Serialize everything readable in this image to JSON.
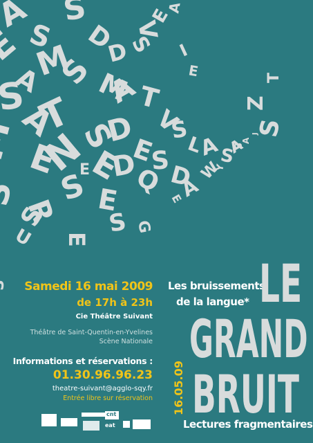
{
  "event": {
    "date": "Samedi 16 mai 2009",
    "hours": "de 17h à 23h",
    "company": "Cie Théâtre Suivant",
    "venue_line1": "Théâtre de Saint-Quentin-en-Yvelines",
    "venue_line2": "Scène Nationale",
    "info_title": "Informations et réservations :",
    "phone": "01.30.96.96.23",
    "email": "theatre-suivant@agglo-sqy.fr",
    "admission": "Entrée libre sur réservation"
  },
  "title": {
    "subtitle_line1": "Les bruissements",
    "subtitle_line2": "de la langue*",
    "line1": "LE",
    "line2": "GRAND",
    "line3": "BRUIT",
    "tagline": "Lectures fragmentaires",
    "vertical_date": "16.05.09"
  },
  "logos": {
    "labels": [
      "eat",
      "cnt"
    ]
  },
  "colors": {
    "background": "#2b7a80",
    "accent": "#f0c419",
    "letters": "#d8dcdc",
    "text": "#ffffff"
  }
}
